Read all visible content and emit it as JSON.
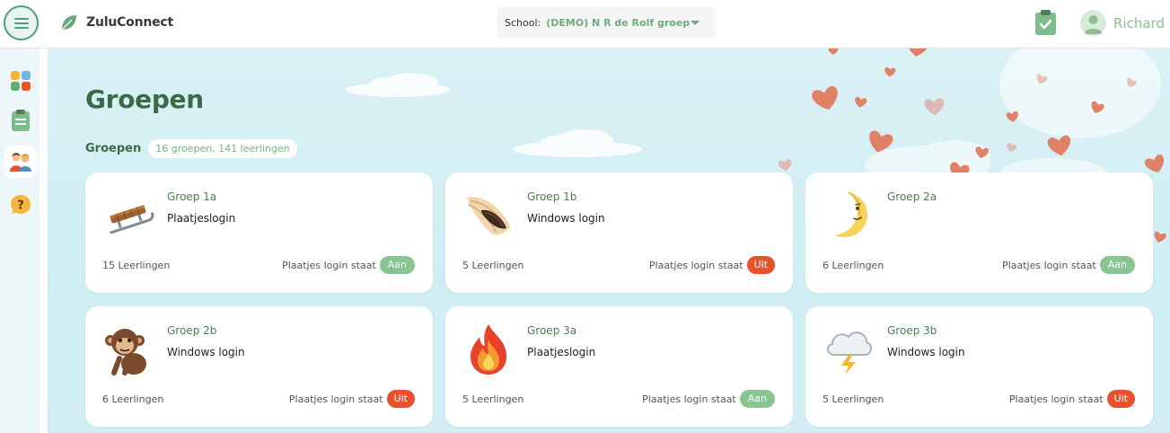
{
  "header": {
    "app_name": "ZuluConnect",
    "school_label": "School:",
    "school_value": "(DEMO) N R de Rolf groep",
    "user_name": "Richard"
  },
  "icons": {
    "menu": "hamburger-menu-icon",
    "logo": "leaf-icon",
    "clipboard": "clipboard-check-icon",
    "user": "user-avatar-icon"
  },
  "sidebar": {
    "items": [
      {
        "name": "apps",
        "icon": "app-grid-icon"
      },
      {
        "name": "tasks",
        "icon": "clipboard-icon"
      },
      {
        "name": "groups",
        "icon": "group-people-icon",
        "active": true
      },
      {
        "name": "help",
        "icon": "help-bubble-icon"
      }
    ]
  },
  "page": {
    "title": "Groepen",
    "section_title": "Groepen",
    "section_count": "16 groepen, 141 leerlingen"
  },
  "groups": [
    {
      "name": "Groep 1a",
      "login": "Plaatjeslogin",
      "students": "15 Leerlingen",
      "status_label": "Plaatjes login staat",
      "status": "Aan",
      "status_state": "on",
      "icon": "sled-icon"
    },
    {
      "name": "Groep 1b",
      "login": "Windows login",
      "students": "5 Leerlingen",
      "status_label": "Plaatjes login staat",
      "status": "Uit",
      "status_state": "off",
      "icon": "seashell-icon"
    },
    {
      "name": "Groep 2a",
      "login": "",
      "students": "6 Leerlingen",
      "status_label": "Plaatjes login staat",
      "status": "Aan",
      "status_state": "on",
      "icon": "crescent-moon-face-icon"
    },
    {
      "name": "Groep 2b",
      "login": "Windows login",
      "students": "6 Leerlingen",
      "status_label": "Plaatjes login staat",
      "status": "Uit",
      "status_state": "off",
      "icon": "monkey-icon"
    },
    {
      "name": "Groep 3a",
      "login": "Plaatjeslogin",
      "students": "5 Leerlingen",
      "status_label": "Plaatjes login staat",
      "status": "Aan",
      "status_state": "on",
      "icon": "fire-icon"
    },
    {
      "name": "Groep 3b",
      "login": "Windows login",
      "students": "5 Leerlingen",
      "status_label": "Plaatjes login staat",
      "status": "Uit",
      "status_state": "off",
      "icon": "cloud-lightning-icon"
    }
  ],
  "colors": {
    "accent_green": "#3b6b46",
    "light_green": "#88c592",
    "off_red": "#e8512b",
    "background": "#d8f0f5",
    "heart": "#e07a5f"
  }
}
